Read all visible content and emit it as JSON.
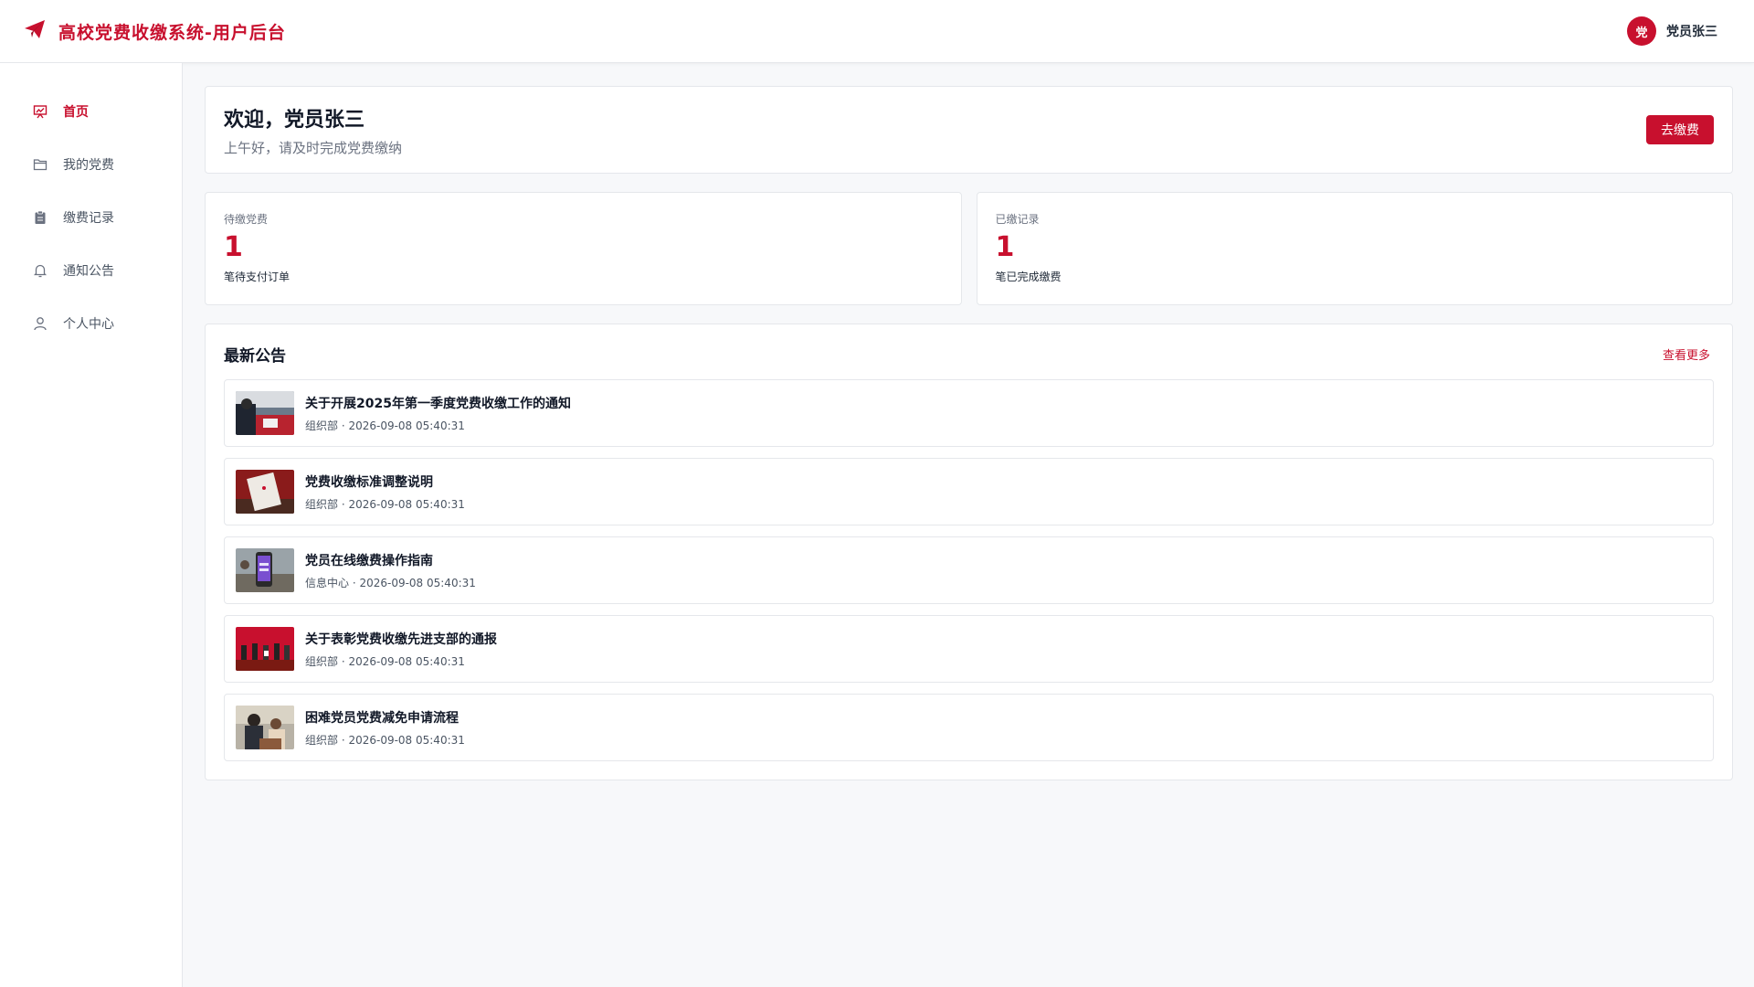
{
  "header": {
    "title": "高校党费收缴系统-用户后台",
    "avatar_text": "党",
    "user_name": "党员张三"
  },
  "sidebar": {
    "items": [
      {
        "label": "首页",
        "icon": "presentation-icon",
        "active": true
      },
      {
        "label": "我的党费",
        "icon": "folder-icon"
      },
      {
        "label": "缴费记录",
        "icon": "clipboard-icon"
      },
      {
        "label": "通知公告",
        "icon": "bell-icon"
      },
      {
        "label": "个人中心",
        "icon": "user-icon"
      }
    ]
  },
  "welcome": {
    "title": "欢迎，党员张三",
    "subtitle": "上午好，请及时完成党费缴纳",
    "button": "去缴费"
  },
  "stats": [
    {
      "label": "待缴党费",
      "value": "1",
      "desc": "笔待支付订单"
    },
    {
      "label": "已缴记录",
      "value": "1",
      "desc": "笔已完成缴费"
    }
  ],
  "notices": {
    "title": "最新公告",
    "more": "查看更多",
    "items": [
      {
        "title": "关于开展2025年第一季度党费收缴工作的通知",
        "meta": "组织部 · 2026-09-08 05:40:31"
      },
      {
        "title": "党费收缴标准调整说明",
        "meta": "组织部 · 2026-09-08 05:40:31"
      },
      {
        "title": "党员在线缴费操作指南",
        "meta": "信息中心 · 2026-09-08 05:40:31"
      },
      {
        "title": "关于表彰党费收缴先进支部的通报",
        "meta": "组织部 · 2026-09-08 05:40:31"
      },
      {
        "title": "困难党员党费减免申请流程",
        "meta": "组织部 · 2026-09-08 05:40:31"
      }
    ]
  },
  "colors": {
    "accent": "#c8102e",
    "background": "#f7f8fa"
  }
}
